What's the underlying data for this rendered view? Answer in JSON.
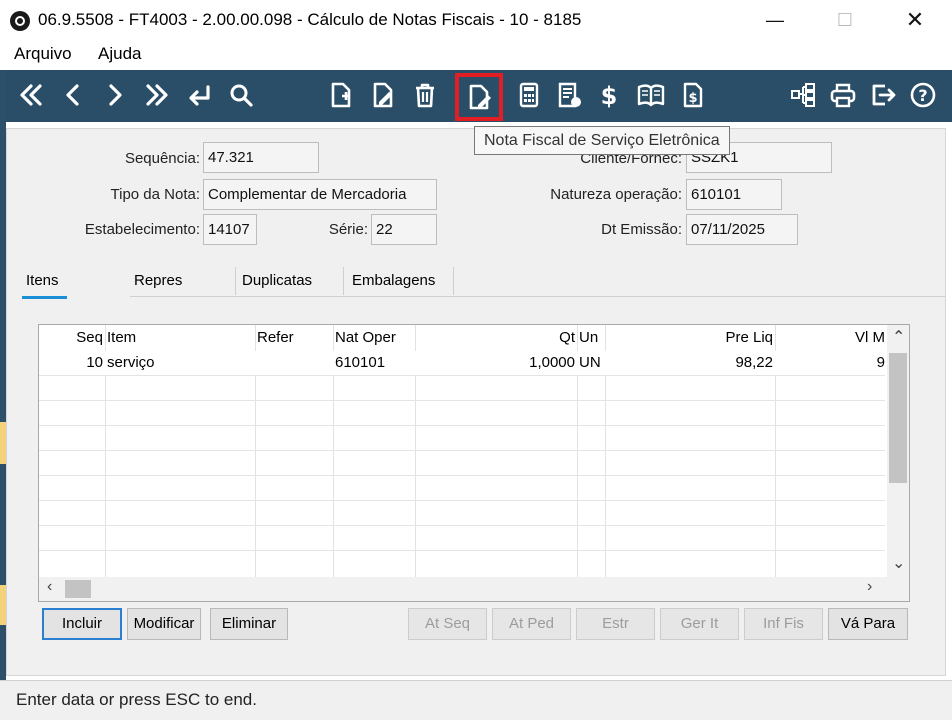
{
  "window": {
    "title": "06.9.5508 - FT4003 - 2.00.00.098 - Cálculo de Notas Fiscais - 10 - 8185",
    "minimize_glyph": "—",
    "maximize_glyph": "☐",
    "close_glyph": "✕"
  },
  "menu": {
    "file": "Arquivo",
    "help": "Ajuda"
  },
  "toolbar": {
    "icons": [
      "first-icon",
      "previous-icon",
      "next-icon",
      "last-icon",
      "return-icon",
      "search-icon",
      "new-document-icon",
      "edit-document-icon",
      "trash-icon",
      "nfse-document-icon",
      "calculator-icon",
      "list-document-icon",
      "dollar-icon",
      "book-icon",
      "money-document-icon",
      "tree-icon",
      "print-icon",
      "exit-icon",
      "help-icon"
    ],
    "highlight_color": "#e01e24",
    "bg_color": "#2a4d68"
  },
  "tooltip": "Nota Fiscal de Serviço Eletrônica",
  "form": {
    "sequencia_label": "Sequência:",
    "sequencia_value": "47.321",
    "tipo_label": "Tipo da Nota:",
    "tipo_value": "Complementar de Mercadoria",
    "estab_label": "Estabelecimento:",
    "estab_value": "14107",
    "serie_label": "Série:",
    "serie_value": "22",
    "cliente_label": "Cliente/Fornec:",
    "cliente_value": "SSZK1",
    "natureza_label": "Natureza operação:",
    "natureza_value": "610101",
    "dt_label": "Dt Emissão:",
    "dt_value": "07/11/2025"
  },
  "tabs": [
    "Itens",
    "Repres",
    "Duplicatas",
    "Embalagens"
  ],
  "grid": {
    "headers": {
      "seq": "Seq",
      "item": "Item",
      "refer": "Refer",
      "nat": "Nat Oper",
      "qt": "Qt",
      "un": "Un",
      "preliq": "Pre Liq",
      "vlm": "Vl M"
    },
    "rows": [
      {
        "seq": "10",
        "item": "serviço",
        "refer": "",
        "nat": "610101",
        "qt": "1,0000",
        "un": "UN",
        "preliq": "98,22",
        "vlm": "9"
      }
    ]
  },
  "buttons": {
    "incluir": "Incluir",
    "modificar": "Modificar",
    "eliminar": "Eliminar",
    "at_seq": "At Seq",
    "at_ped": "At Ped",
    "estr": "Estr",
    "ger_it": "Ger It",
    "inf_fis": "Inf Fis",
    "va_para": "Vá Para"
  },
  "status": "Enter data or press ESC to end."
}
